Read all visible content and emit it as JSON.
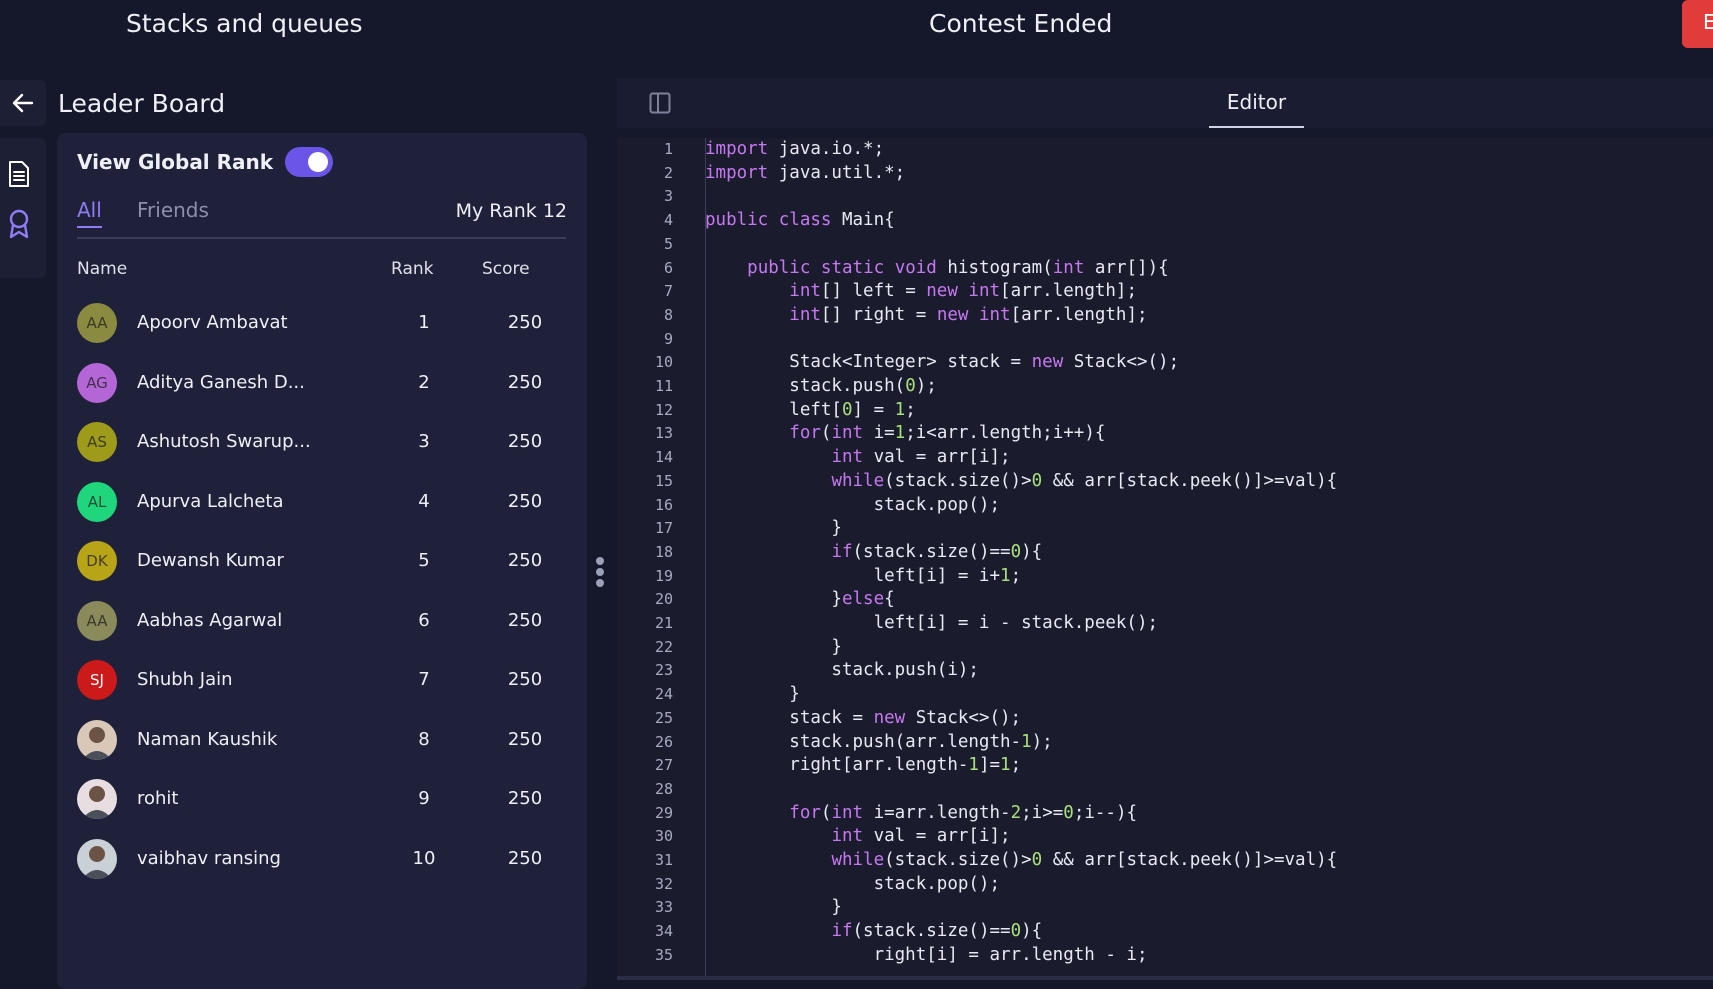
{
  "header": {
    "contest_title": "Stacks and queues",
    "status": "Contest Ended",
    "end_button_label": "E"
  },
  "leaderboard": {
    "title": "Leader Board",
    "global_rank_label": "View Global Rank",
    "global_rank_enabled": true,
    "tabs": {
      "all": "All",
      "friends": "Friends"
    },
    "my_rank": "My Rank 12",
    "columns": {
      "name": "Name",
      "rank": "Rank",
      "score": "Score"
    },
    "rows": [
      {
        "initials": "AA",
        "name": "Apoorv Ambavat",
        "rank": "1",
        "score": "250",
        "color": "#8a8a40"
      },
      {
        "initials": "AG",
        "name": "Aditya Ganesh D...",
        "rank": "2",
        "score": "250",
        "color": "#b466d6"
      },
      {
        "initials": "AS",
        "name": "Ashutosh Swarup...",
        "rank": "3",
        "score": "250",
        "color": "#9e9a1a"
      },
      {
        "initials": "AL",
        "name": "Apurva Lalcheta",
        "rank": "4",
        "score": "250",
        "color": "#1fd67c"
      },
      {
        "initials": "DK",
        "name": "Dewansh Kumar",
        "rank": "5",
        "score": "250",
        "color": "#b7a417"
      },
      {
        "initials": "AA",
        "name": "Aabhas Agarwal",
        "rank": "6",
        "score": "250",
        "color": "#8a8a5a"
      },
      {
        "initials": "SJ",
        "name": "Shubh Jain",
        "rank": "7",
        "score": "250",
        "color": "#cc1a1a"
      },
      {
        "initials": "",
        "name": "Naman Kaushik",
        "rank": "8",
        "score": "250",
        "color": "#d9c7b8"
      },
      {
        "initials": "",
        "name": "rohit",
        "rank": "9",
        "score": "250",
        "color": "#e8dde0"
      },
      {
        "initials": "",
        "name": "vaibhav ransing",
        "rank": "10",
        "score": "250",
        "color": "#c9d0d6"
      }
    ]
  },
  "editor": {
    "tab_label": "Editor",
    "lines": [
      "import java.io.*;",
      "import java.util.*;",
      "",
      "public class Main{",
      "",
      "    public static void histogram(int arr[]){",
      "        int[] left = new int[arr.length];",
      "        int[] right = new int[arr.length];",
      "",
      "        Stack<Integer> stack = new Stack<>();",
      "        stack.push(0);",
      "        left[0] = 1;",
      "        for(int i=1;i<arr.length;i++){",
      "            int val = arr[i];",
      "            while(stack.size()>0 && arr[stack.peek()]>=val){",
      "                stack.pop();",
      "            }",
      "            if(stack.size()==0){",
      "                left[i] = i+1;",
      "            }else{",
      "                left[i] = i - stack.peek();",
      "            }",
      "            stack.push(i);",
      "        }",
      "        stack = new Stack<>();",
      "        stack.push(arr.length-1);",
      "        right[arr.length-1]=1;",
      "",
      "        for(int i=arr.length-2;i>=0;i--){",
      "            int val = arr[i];",
      "            while(stack.size()>0 && arr[stack.peek()]>=val){",
      "                stack.pop();",
      "            }",
      "            if(stack.size()==0){",
      "                right[i] = arr.length - i;"
    ]
  }
}
